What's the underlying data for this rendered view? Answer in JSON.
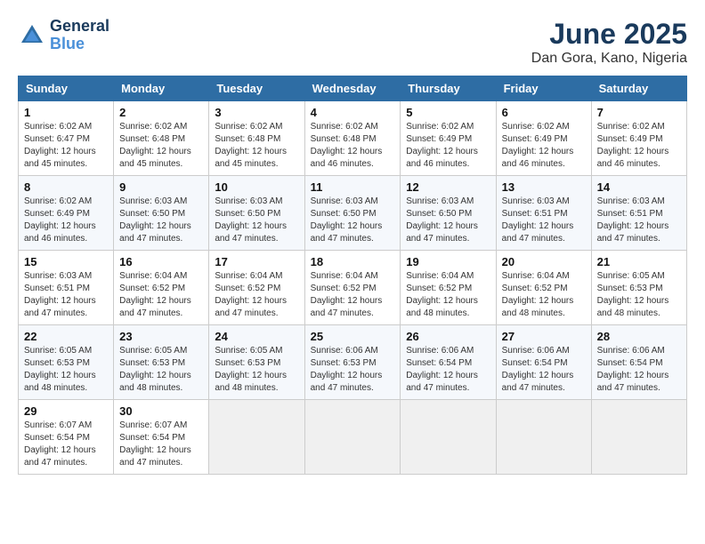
{
  "header": {
    "logo_line1": "General",
    "logo_line2": "Blue",
    "title": "June 2025",
    "subtitle": "Dan Gora, Kano, Nigeria"
  },
  "columns": [
    "Sunday",
    "Monday",
    "Tuesday",
    "Wednesday",
    "Thursday",
    "Friday",
    "Saturday"
  ],
  "weeks": [
    [
      {
        "day": "1",
        "rise": "6:02 AM",
        "set": "6:47 PM",
        "hours": "12 hours and 45 minutes."
      },
      {
        "day": "2",
        "rise": "6:02 AM",
        "set": "6:48 PM",
        "hours": "12 hours and 45 minutes."
      },
      {
        "day": "3",
        "rise": "6:02 AM",
        "set": "6:48 PM",
        "hours": "12 hours and 45 minutes."
      },
      {
        "day": "4",
        "rise": "6:02 AM",
        "set": "6:48 PM",
        "hours": "12 hours and 46 minutes."
      },
      {
        "day": "5",
        "rise": "6:02 AM",
        "set": "6:49 PM",
        "hours": "12 hours and 46 minutes."
      },
      {
        "day": "6",
        "rise": "6:02 AM",
        "set": "6:49 PM",
        "hours": "12 hours and 46 minutes."
      },
      {
        "day": "7",
        "rise": "6:02 AM",
        "set": "6:49 PM",
        "hours": "12 hours and 46 minutes."
      }
    ],
    [
      {
        "day": "8",
        "rise": "6:02 AM",
        "set": "6:49 PM",
        "hours": "12 hours and 46 minutes."
      },
      {
        "day": "9",
        "rise": "6:03 AM",
        "set": "6:50 PM",
        "hours": "12 hours and 47 minutes."
      },
      {
        "day": "10",
        "rise": "6:03 AM",
        "set": "6:50 PM",
        "hours": "12 hours and 47 minutes."
      },
      {
        "day": "11",
        "rise": "6:03 AM",
        "set": "6:50 PM",
        "hours": "12 hours and 47 minutes."
      },
      {
        "day": "12",
        "rise": "6:03 AM",
        "set": "6:50 PM",
        "hours": "12 hours and 47 minutes."
      },
      {
        "day": "13",
        "rise": "6:03 AM",
        "set": "6:51 PM",
        "hours": "12 hours and 47 minutes."
      },
      {
        "day": "14",
        "rise": "6:03 AM",
        "set": "6:51 PM",
        "hours": "12 hours and 47 minutes."
      }
    ],
    [
      {
        "day": "15",
        "rise": "6:03 AM",
        "set": "6:51 PM",
        "hours": "12 hours and 47 minutes."
      },
      {
        "day": "16",
        "rise": "6:04 AM",
        "set": "6:52 PM",
        "hours": "12 hours and 47 minutes."
      },
      {
        "day": "17",
        "rise": "6:04 AM",
        "set": "6:52 PM",
        "hours": "12 hours and 47 minutes."
      },
      {
        "day": "18",
        "rise": "6:04 AM",
        "set": "6:52 PM",
        "hours": "12 hours and 47 minutes."
      },
      {
        "day": "19",
        "rise": "6:04 AM",
        "set": "6:52 PM",
        "hours": "12 hours and 48 minutes."
      },
      {
        "day": "20",
        "rise": "6:04 AM",
        "set": "6:52 PM",
        "hours": "12 hours and 48 minutes."
      },
      {
        "day": "21",
        "rise": "6:05 AM",
        "set": "6:53 PM",
        "hours": "12 hours and 48 minutes."
      }
    ],
    [
      {
        "day": "22",
        "rise": "6:05 AM",
        "set": "6:53 PM",
        "hours": "12 hours and 48 minutes."
      },
      {
        "day": "23",
        "rise": "6:05 AM",
        "set": "6:53 PM",
        "hours": "12 hours and 48 minutes."
      },
      {
        "day": "24",
        "rise": "6:05 AM",
        "set": "6:53 PM",
        "hours": "12 hours and 48 minutes."
      },
      {
        "day": "25",
        "rise": "6:06 AM",
        "set": "6:53 PM",
        "hours": "12 hours and 47 minutes."
      },
      {
        "day": "26",
        "rise": "6:06 AM",
        "set": "6:54 PM",
        "hours": "12 hours and 47 minutes."
      },
      {
        "day": "27",
        "rise": "6:06 AM",
        "set": "6:54 PM",
        "hours": "12 hours and 47 minutes."
      },
      {
        "day": "28",
        "rise": "6:06 AM",
        "set": "6:54 PM",
        "hours": "12 hours and 47 minutes."
      }
    ],
    [
      {
        "day": "29",
        "rise": "6:07 AM",
        "set": "6:54 PM",
        "hours": "12 hours and 47 minutes."
      },
      {
        "day": "30",
        "rise": "6:07 AM",
        "set": "6:54 PM",
        "hours": "12 hours and 47 minutes."
      },
      null,
      null,
      null,
      null,
      null
    ]
  ]
}
